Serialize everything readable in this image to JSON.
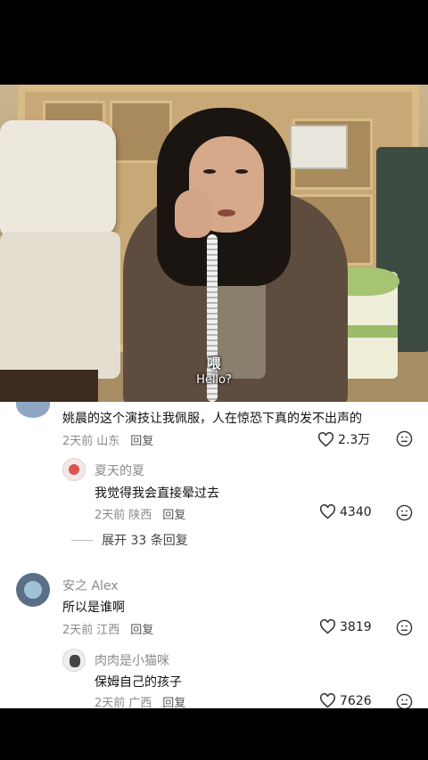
{
  "video": {
    "subtitle_cn": "喂",
    "subtitle_en": "Hello?"
  },
  "comments": [
    {
      "text": "姚晨的这个演技让我佩服，人在惊恐下真的发不出声的",
      "time": "2天前",
      "location": "山东",
      "reply": "回复",
      "likes": "2.3万"
    },
    {
      "name": "夏天的夏",
      "text": "我觉得我会直接晕过去",
      "time": "2天前",
      "location": "陕西",
      "reply": "回复",
      "likes": "4340"
    },
    {
      "name": "安之 Alex",
      "text": "所以是谁啊",
      "time": "2天前",
      "location": "江西",
      "reply": "回复",
      "likes": "3819"
    },
    {
      "name": "肉肉是小猫咪",
      "text": "保姆自己的孩子",
      "time": "2天前",
      "location": "广西",
      "reply": "回复",
      "likes": "7626"
    }
  ],
  "expand_replies": "展开 33 条回复",
  "icons": {
    "like": "heart-outline-icon",
    "dislike": "frown-face-icon"
  }
}
